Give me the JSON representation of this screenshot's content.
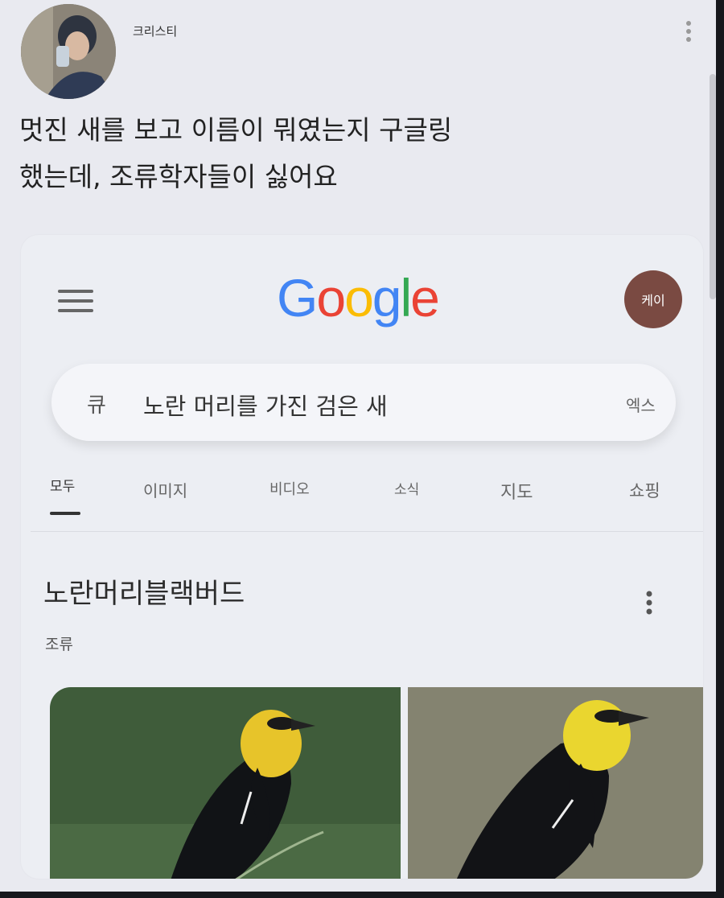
{
  "post": {
    "username": "크리스티",
    "caption_line1": "멋진 새를 보고 이름이 뭐였는지 구글링",
    "caption_line2": "했는데, 조류학자들이 싫어요"
  },
  "google": {
    "logo": {
      "letters": [
        "G",
        "o",
        "o",
        "g",
        "l",
        "e"
      ],
      "colors": [
        "#4285F4",
        "#EA4335",
        "#FBBC05",
        "#4285F4",
        "#34A853",
        "#EA4335"
      ]
    },
    "account_label": "케이",
    "search": {
      "prefix": "큐",
      "query": "노란 머리를 가진 검은 새",
      "clear_label": "엑스"
    },
    "tabs": [
      {
        "label": "모두",
        "active": true
      },
      {
        "label": "이미지",
        "active": false
      },
      {
        "label": "비디오",
        "active": false
      },
      {
        "label": "소식",
        "active": false
      },
      {
        "label": "지도",
        "active": false
      },
      {
        "label": "쇼핑",
        "active": false
      }
    ],
    "knowledge_panel": {
      "title": "노란머리블랙버드",
      "subtitle": "조류"
    }
  }
}
